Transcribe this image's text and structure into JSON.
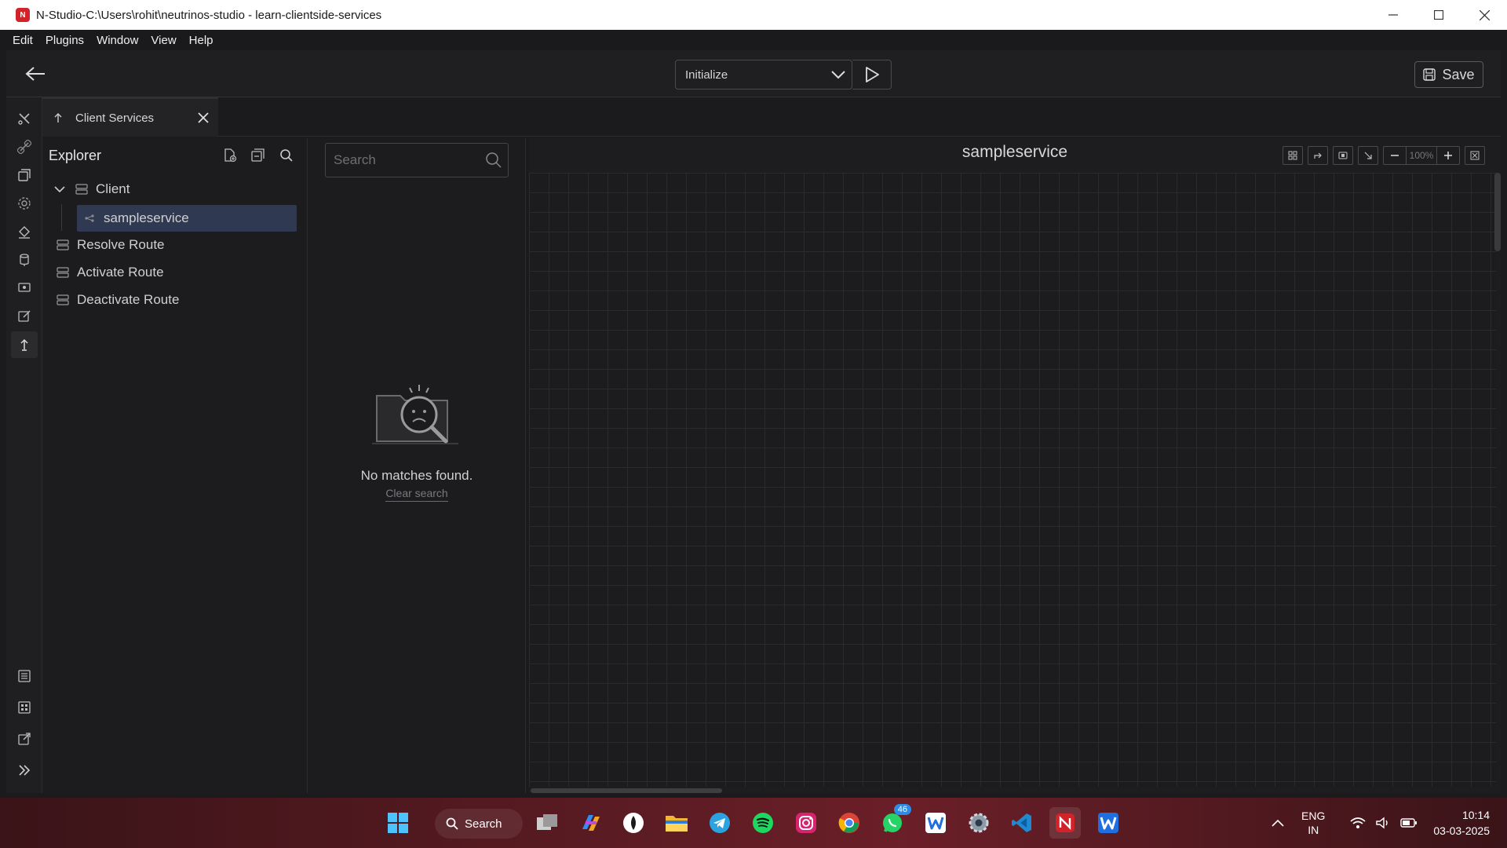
{
  "window": {
    "title": "N-Studio-C:\\Users\\rohit\\neutrinos-studio - learn-clientside-services",
    "logo_text": "N"
  },
  "menu": {
    "items": [
      "Edit",
      "Plugins",
      "Window",
      "View",
      "Help"
    ]
  },
  "toolbar": {
    "trigger_select_value": "Initialize",
    "save_label": "Save"
  },
  "tab": {
    "label": "Client Services"
  },
  "explorer": {
    "title": "Explorer",
    "tree": [
      {
        "label": "Client"
      },
      {
        "label": "sampleservice"
      },
      {
        "label": "Resolve Route"
      },
      {
        "label": "Activate Route"
      },
      {
        "label": "Deactivate Route"
      }
    ]
  },
  "search": {
    "placeholder": "Search",
    "empty_message": "No matches found.",
    "clear_label": "Clear search"
  },
  "canvas": {
    "title": "sampleservice",
    "zoom": "100%"
  },
  "taskbar": {
    "search_label": "Search",
    "whatsapp_badge": "46",
    "lang_line1": "ENG",
    "lang_line2": "IN",
    "time": "10:14",
    "date": "03-03-2025"
  },
  "colors": {
    "accent_selected": "#2f3a52",
    "brand_red": "#d2232a"
  }
}
